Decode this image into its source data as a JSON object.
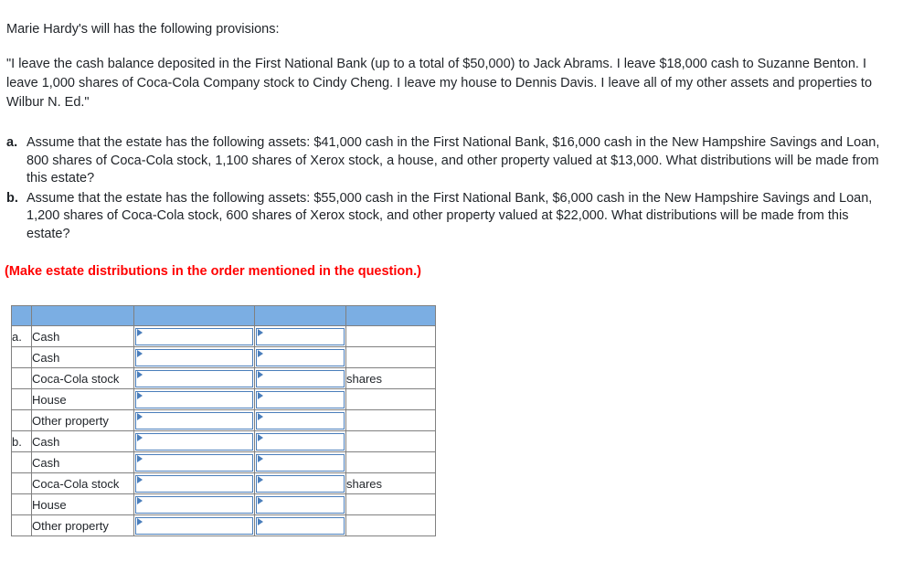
{
  "intro": {
    "line": "Marie Hardy's will has the following provisions:"
  },
  "will_quote": {
    "text": "\"I leave the cash balance deposited in the First National Bank (up to a total of $50,000) to Jack Abrams. I leave $18,000 cash to Suzanne Benton. I leave 1,000 shares of Coca-Cola Company stock to Cindy Cheng. I leave my house to Dennis Davis. I leave all of my other assets and properties to Wilbur N. Ed.\""
  },
  "assumptions": [
    {
      "marker": "a.",
      "text": "Assume that the estate has the following assets: $41,000 cash in the First National Bank, $16,000 cash in the New Hampshire Savings and Loan, 800 shares of Coca-Cola stock, 1,100 shares of Xerox stock, a house, and other property valued at $13,000. What distributions will be made from this estate?"
    },
    {
      "marker": "b.",
      "text": "Assume that the estate has the following assets: $55,000 cash in the First National Bank, $6,000 cash in the New Hampshire Savings and Loan, 1,200 shares of Coca-Cola stock, 600 shares of Xerox stock, and other property valued at $22,000. What distributions will be made from this estate?"
    }
  ],
  "order_note": {
    "text": "(Make estate distributions in the order mentioned in the question.)"
  },
  "table": {
    "headers": [
      "",
      "",
      "",
      "",
      ""
    ],
    "rows": [
      {
        "letter": "a.",
        "label": "Cash",
        "answer1": "",
        "answer2": "",
        "unit": ""
      },
      {
        "letter": "",
        "label": "Cash",
        "answer1": "",
        "answer2": "",
        "unit": ""
      },
      {
        "letter": "",
        "label": "Coca-Cola stock",
        "answer1": "",
        "answer2": "",
        "unit": "shares"
      },
      {
        "letter": "",
        "label": "House",
        "answer1": "",
        "answer2": "",
        "unit": ""
      },
      {
        "letter": "",
        "label": "Other property",
        "answer1": "",
        "answer2": "",
        "unit": ""
      },
      {
        "letter": "b.",
        "label": "Cash",
        "answer1": "",
        "answer2": "",
        "unit": ""
      },
      {
        "letter": "",
        "label": "Cash",
        "answer1": "",
        "answer2": "",
        "unit": ""
      },
      {
        "letter": "",
        "label": "Coca-Cola stock",
        "answer1": "",
        "answer2": "",
        "unit": "shares"
      },
      {
        "letter": "",
        "label": "House",
        "answer1": "",
        "answer2": "",
        "unit": ""
      },
      {
        "letter": "",
        "label": "Other property",
        "answer1": "",
        "answer2": "",
        "unit": ""
      }
    ]
  },
  "colors": {
    "header_blue": "#7BAEE3",
    "input_border_blue": "#4A7EBB",
    "grid_gray": "#808080",
    "note_red": "#ff0000"
  }
}
